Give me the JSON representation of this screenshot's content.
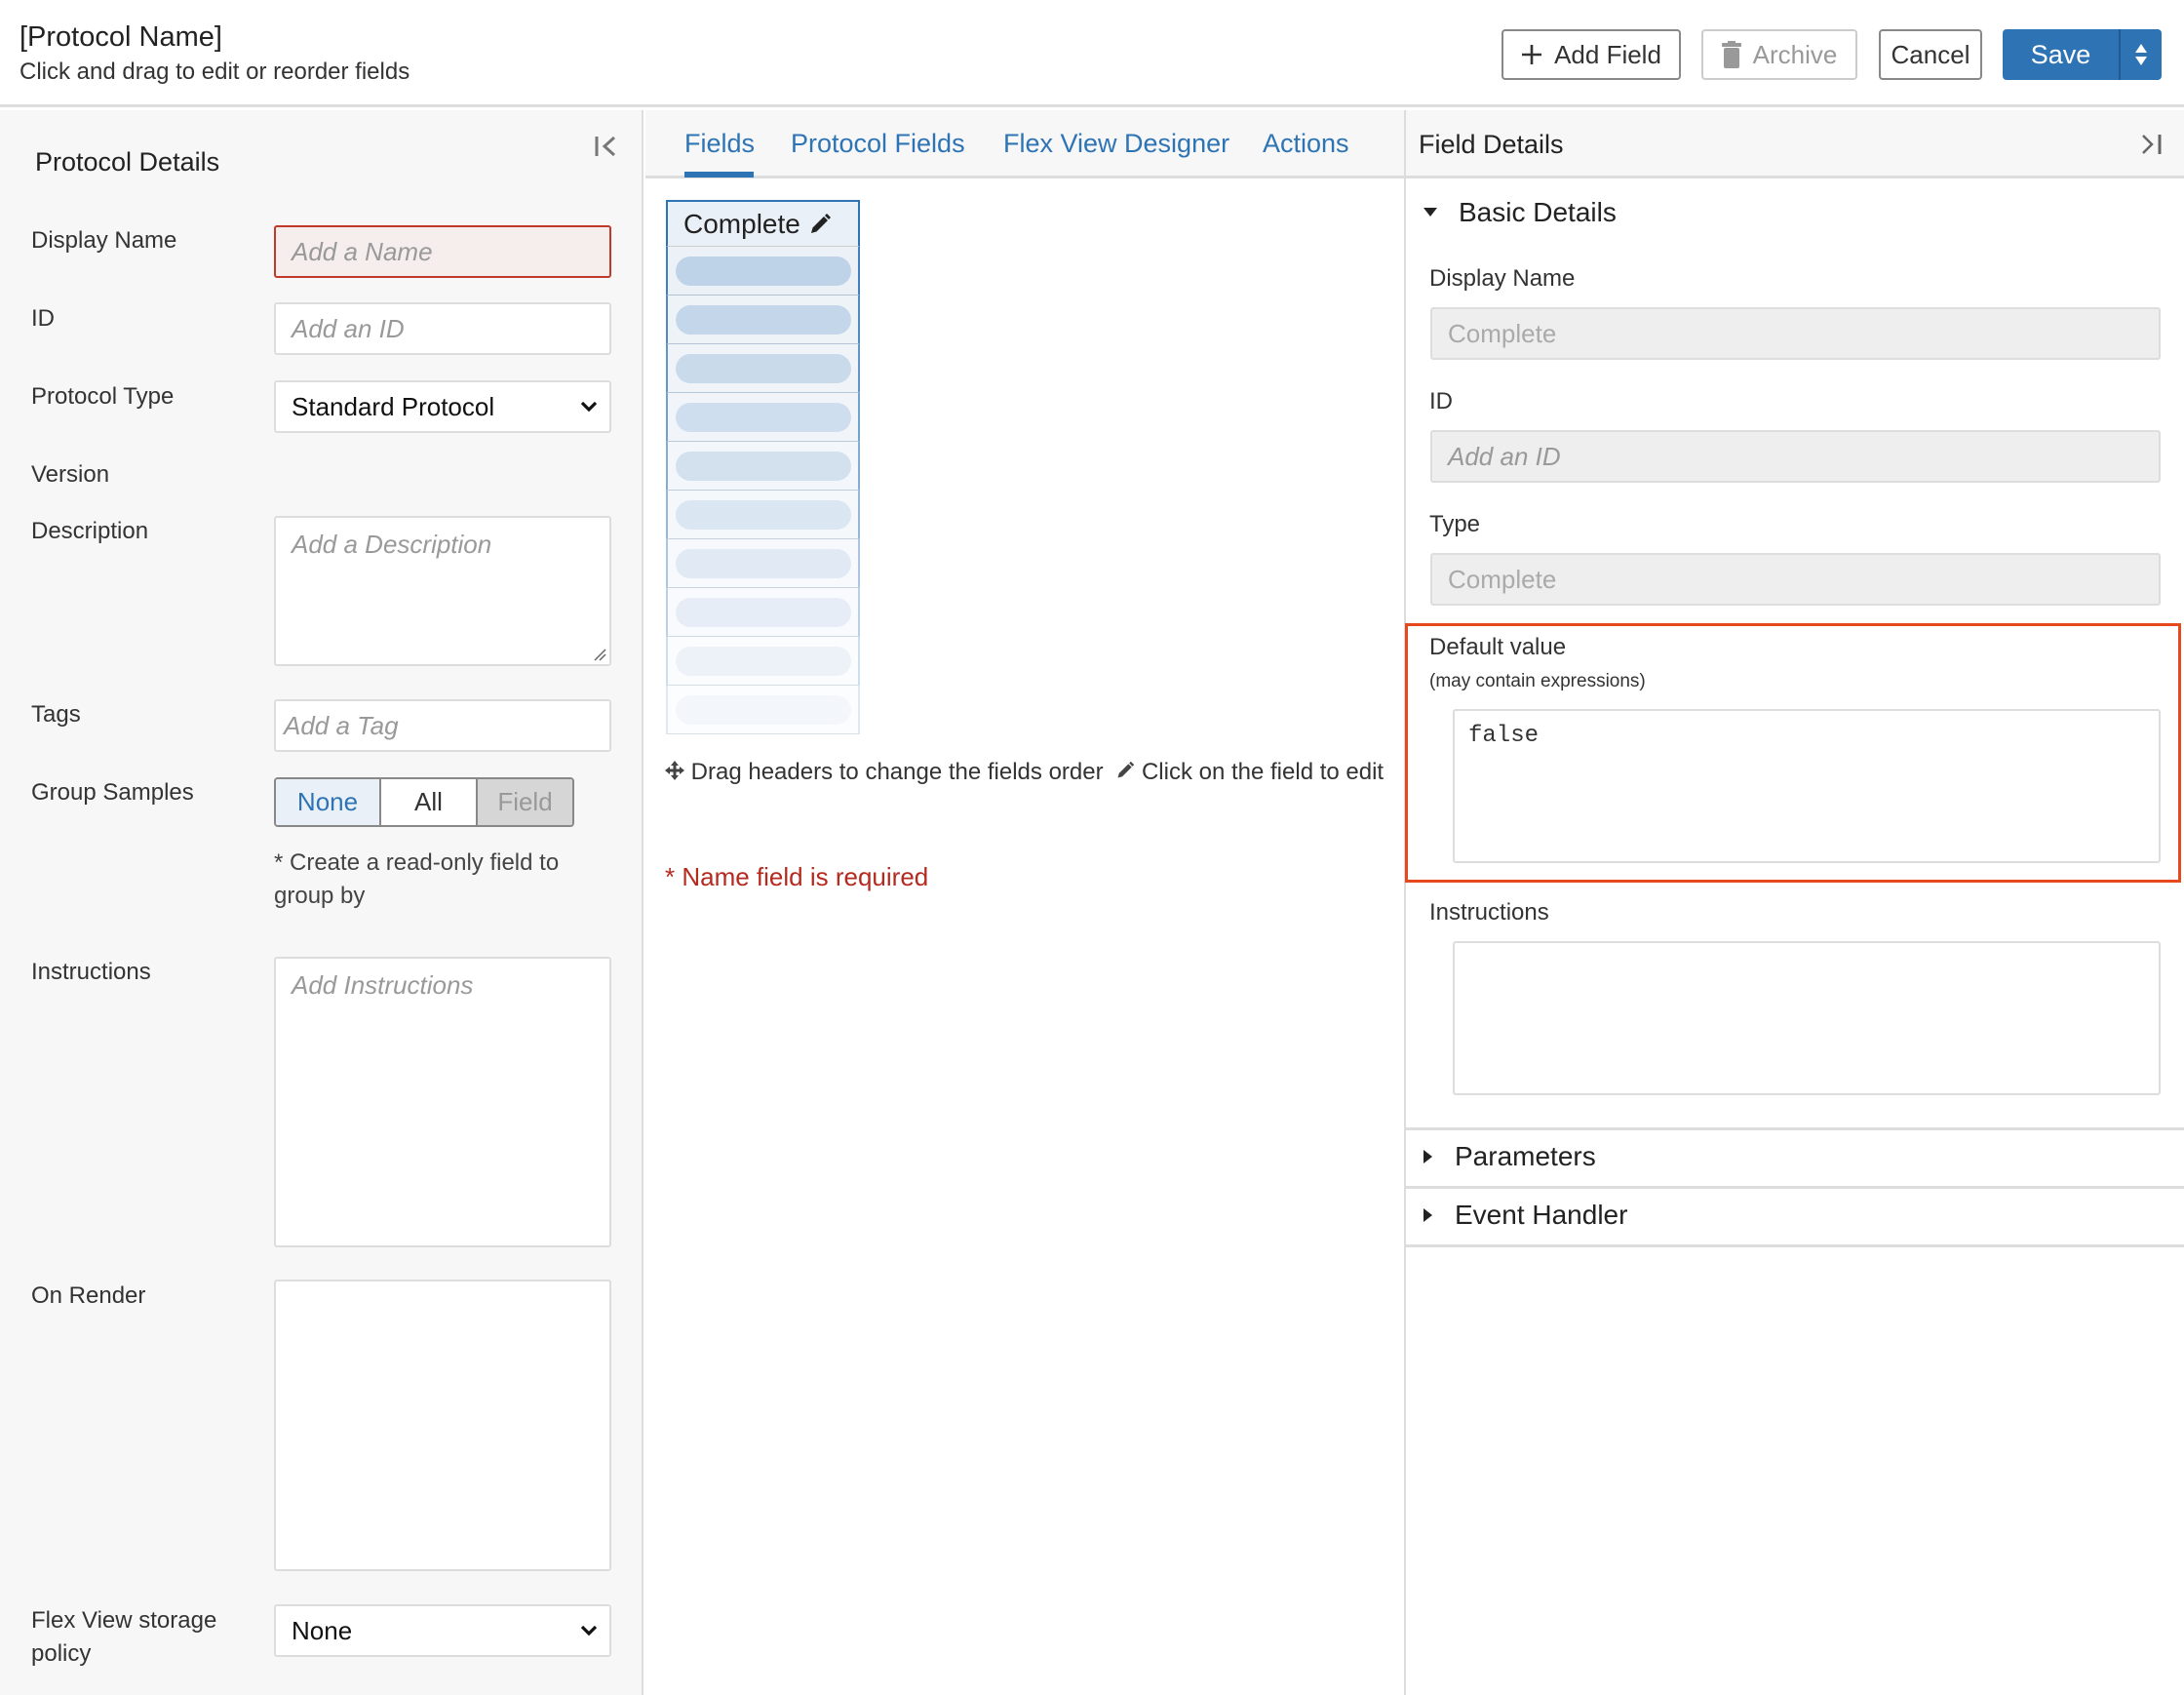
{
  "header": {
    "title": "[Protocol Name]",
    "subtitle": "Click and drag to edit or reorder fields",
    "buttons": {
      "add_field": "Add Field",
      "archive": "Archive",
      "cancel": "Cancel",
      "save": "Save"
    }
  },
  "left_panel": {
    "title": "Protocol Details",
    "display_name": {
      "label": "Display Name",
      "placeholder": "Add a Name"
    },
    "id": {
      "label": "ID",
      "placeholder": "Add an ID"
    },
    "protocol_type": {
      "label": "Protocol Type",
      "value": "Standard Protocol"
    },
    "version": {
      "label": "Version"
    },
    "description": {
      "label": "Description",
      "placeholder": "Add a Description"
    },
    "tags": {
      "label": "Tags",
      "placeholder": "Add a Tag"
    },
    "group_samples": {
      "label": "Group Samples",
      "options": [
        "None",
        "All",
        "Field"
      ],
      "selected": "None",
      "note": "* Create a read-only field to group by"
    },
    "instructions": {
      "label": "Instructions",
      "placeholder": "Add Instructions"
    },
    "on_render": {
      "label": "On Render",
      "value": ""
    },
    "flex_view_storage": {
      "label": "Flex View storage policy",
      "value": "None"
    }
  },
  "middle_panel": {
    "tabs": [
      {
        "label": "Fields",
        "active": true
      },
      {
        "label": "Protocol Fields",
        "active": false
      },
      {
        "label": "Flex View Designer",
        "active": false
      },
      {
        "label": "Actions",
        "active": false
      }
    ],
    "field_column": {
      "header": "Complete",
      "placeholder_rows": 10
    },
    "drag_hint": "Drag headers to change the fields order",
    "click_hint": "Click on the field to edit",
    "error": "* Name field is required"
  },
  "right_panel": {
    "title": "Field Details",
    "basic_details": {
      "title": "Basic Details",
      "display_name": {
        "label": "Display Name",
        "value": "Complete"
      },
      "id": {
        "label": "ID",
        "placeholder": "Add an ID"
      },
      "type": {
        "label": "Type",
        "value": "Complete"
      },
      "default_value": {
        "label": "Default value",
        "sublabel": "(may contain expressions)",
        "value": "false"
      },
      "instructions": {
        "label": "Instructions",
        "value": ""
      }
    },
    "sections": [
      "Parameters",
      "Event Handler"
    ]
  },
  "colors": {
    "accent": "#2e74b5",
    "error": "#b42a1f",
    "highlight_border": "#e8481e"
  }
}
